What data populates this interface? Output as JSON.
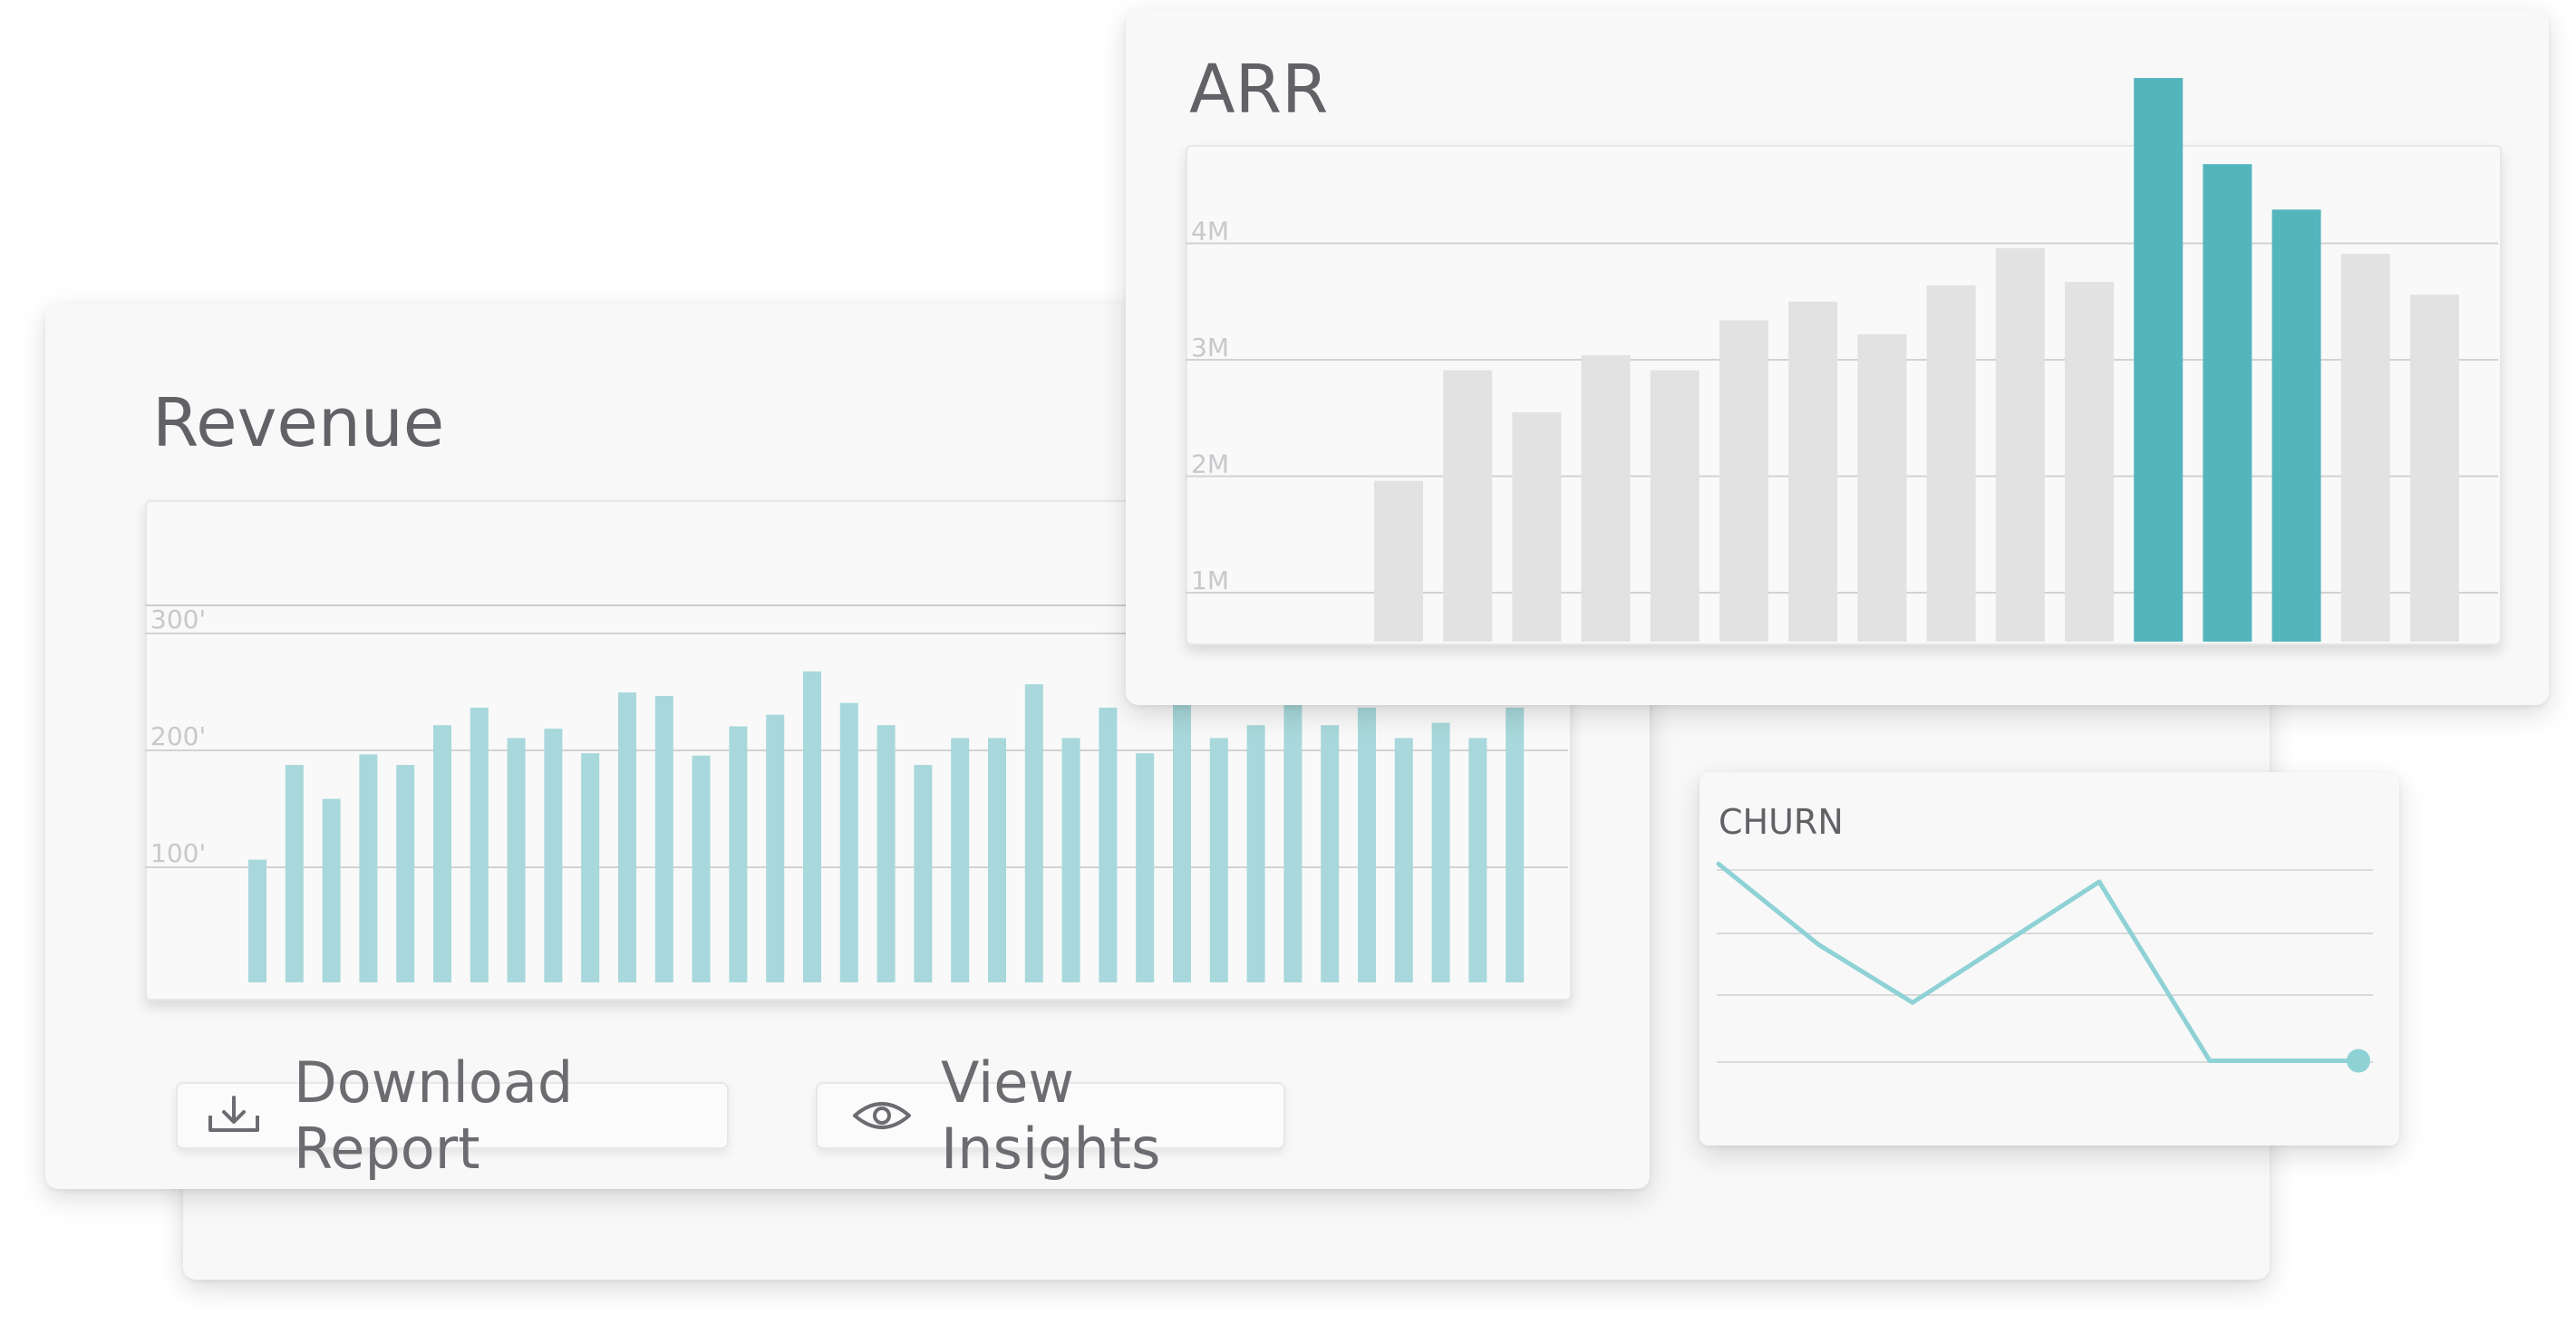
{
  "revenue": {
    "title": "Revenue",
    "download_label": "Download Report",
    "insights_label": "View Insights",
    "icons": {
      "download": "download-icon",
      "insights": "eye-icon"
    },
    "color": "#a8d8db"
  },
  "arr": {
    "title": "ARR",
    "colors": {
      "muted": "#e2e2e2",
      "highlight": "#54b5bd"
    }
  },
  "churn": {
    "title": "CHURN",
    "color": "#8fd2d6"
  },
  "chart_data": [
    {
      "type": "bar",
      "title": "Revenue",
      "y_ticks": [
        "100'",
        "200'",
        "300'"
      ],
      "ylim": [
        0,
        400
      ],
      "grid": true,
      "values": [
        105,
        186,
        157,
        195,
        186,
        220,
        235,
        209,
        217,
        196,
        248,
        245,
        194,
        219,
        229,
        266,
        239,
        220,
        186,
        209,
        209,
        255,
        209,
        235,
        196,
        252,
        209,
        220,
        255,
        220,
        235,
        209,
        222,
        209,
        235
      ]
    },
    {
      "type": "bar",
      "title": "ARR",
      "y_ticks": [
        "1M",
        "2M",
        "3M",
        "4M"
      ],
      "ylim": [
        0,
        4.5
      ],
      "grid": true,
      "values": [
        1.38,
        2.33,
        1.97,
        2.46,
        2.33,
        2.76,
        2.92,
        2.64,
        3.06,
        3.38,
        3.09,
        4.84,
        4.1,
        3.71,
        3.33,
        2.98
      ],
      "highlighted": [
        11,
        12,
        13
      ]
    },
    {
      "type": "line",
      "title": "CHURN",
      "values": [
        4.6,
        3.7,
        3.05,
        4.4,
        2.4,
        2.4
      ],
      "ylim": [
        2.0,
        5.2
      ],
      "grid": true
    }
  ]
}
